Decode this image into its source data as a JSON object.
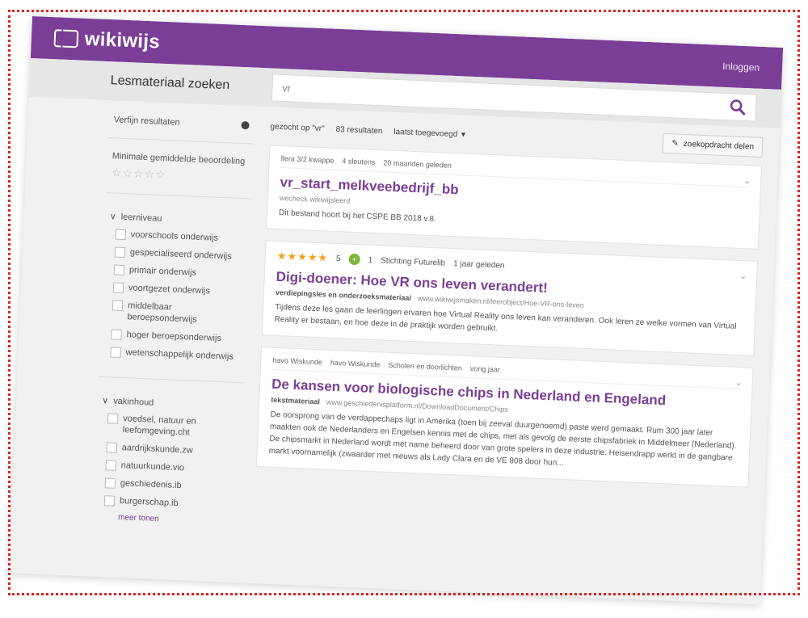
{
  "app": {
    "brand": "wikiwijs",
    "login": "Inloggen"
  },
  "search": {
    "title": "Lesmateriaal zoeken",
    "query": "vr"
  },
  "sidebar": {
    "refine_label": "Verfijn resultaten",
    "rating_label": "Minimale gemiddelde beoordeling",
    "sections": [
      {
        "title": "leerniveau",
        "items": [
          "voorschools onderwijs",
          "gespecialiseerd onderwijs",
          "primair onderwijs",
          "voortgezet onderwijs",
          "middelbaar beroepsonderwijs",
          "hoger beroepsonderwijs",
          "wetenschappelijk onderwijs"
        ]
      },
      {
        "title": "vakinhoud",
        "items": [
          "voedsel, natuur en leefomgeving.cht",
          "aardrijkskunde.zw",
          "natuurkunde.vio",
          "geschiedenis.ib",
          "burgerschap.ib"
        ],
        "more": "meer tonen"
      }
    ]
  },
  "meta": {
    "searched": "gezocht op \"vr\"",
    "count": "83 resultaten",
    "sort": "laatst toegevoegd",
    "save_button": "zoekopdracht delen"
  },
  "results": [
    {
      "tags": [
        "llera 3/2 kwappe",
        "4 sleutens",
        "20 maanden geleden"
      ],
      "title": "vr_start_melkveebedrijf_bb",
      "subtitle": "wecheck.wikiwijsleerd",
      "url": "",
      "desc": "Dit bestand hoort bij het CSPE BB 2018 v.8."
    },
    {
      "rating": 5,
      "rating_count": "5",
      "badge_count": "1",
      "author": "Stichting Futurelib",
      "age": "1 jaar geleden",
      "title": "Digi-doener: Hoe VR ons leven verandert!",
      "subtitle": "verdiepingsles en onderzoeksmateriaal",
      "url": "www.wikiwijsmaken.nl/leerobject/Hoe-VR-ons-leven",
      "desc": "Tijdens deze les gaan de leerlingen ervaren hoe Virtual Reality ons leven kan veranderen. Ook leren ze welke vormen van Virtual Reality er bestaan, en hoe deze in de praktijk worden gebruikt."
    },
    {
      "tags": [
        "havo Wiskunde",
        "havo Wiskunde",
        "Scholen en doorlichten",
        "vorig jaar"
      ],
      "title": "De kansen voor biologische chips in Nederland en Engeland",
      "subtitle": "tekstmateriaal",
      "url": "www.geschiedenisplatform.nl/DownloadDocument/Chips",
      "desc": "De oorsprong van de verdappechaps ligt in Amerika (toen bij zeeval duurgenoemd) paste werd gemaakt. Rum 300 jaar later maakten ook de Nederlanders en Engelsen kennis met de chips, met als gevolg de eerste chipsfabriek in Middelmeer (Nederland). De chipsmarkt in Nederland wordt met name beheerd door van grote spelers in deze industrie. Heisendrapp werkt in de gangbare markt voornamelijk (zwaarder met nieuws als Lady Clara en de VE 808 door hun..."
    }
  ]
}
